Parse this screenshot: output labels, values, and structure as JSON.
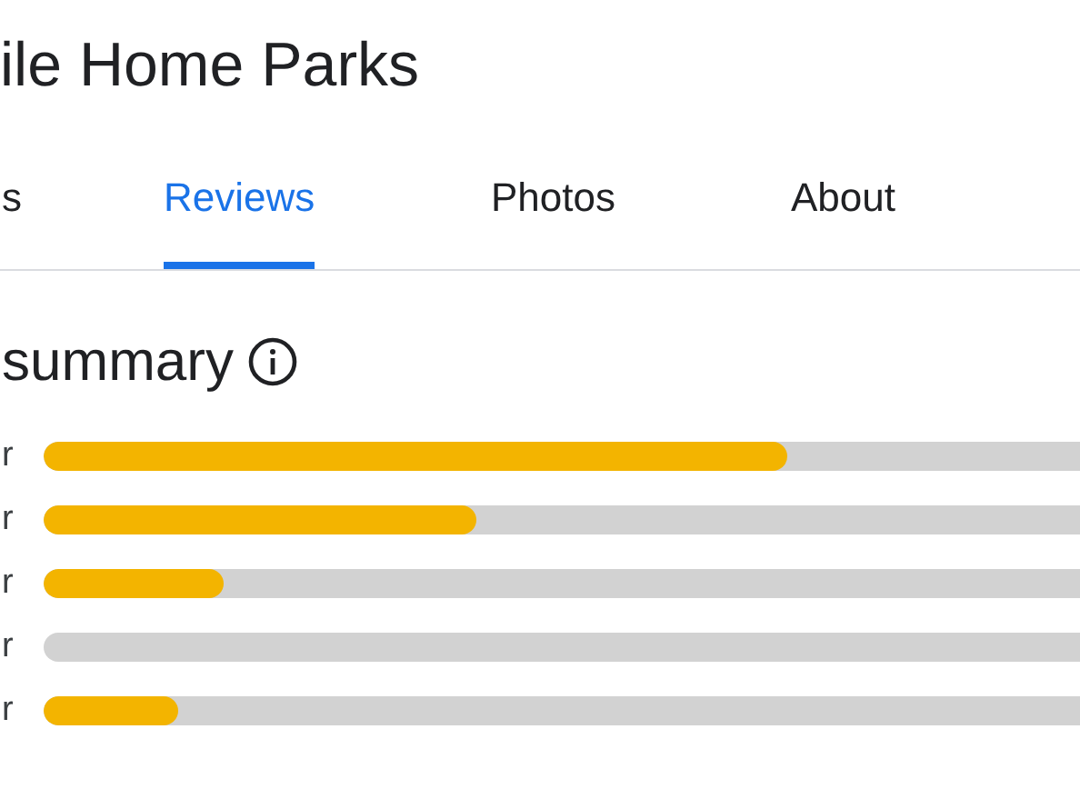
{
  "title": "ile Home Parks",
  "tabs": [
    {
      "label": "s",
      "selected": false
    },
    {
      "label": "Reviews",
      "selected": true
    },
    {
      "label": "Photos",
      "selected": false
    },
    {
      "label": "About",
      "selected": false
    }
  ],
  "summary": {
    "heading": "summary",
    "rows": [
      {
        "label": "r",
        "level": 0.718
      },
      {
        "label": "r",
        "level": 0.417
      },
      {
        "label": "r",
        "level": 0.173
      },
      {
        "label": "r",
        "level": 0
      },
      {
        "label": "r",
        "level": 0.13
      }
    ]
  }
}
